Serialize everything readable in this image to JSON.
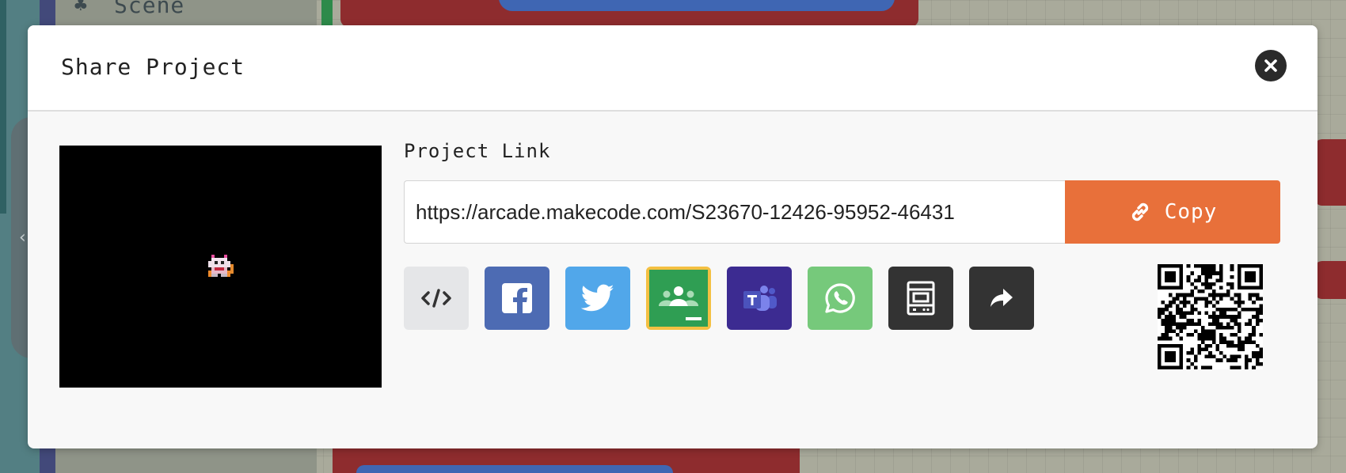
{
  "background": {
    "scene_label": "Scene",
    "scene_icon": "tree-icon"
  },
  "modal": {
    "title": "Share Project",
    "close_icon": "close-icon"
  },
  "project_link": {
    "label": "Project Link",
    "url": "https://arcade.makecode.com/S23670-12426-95952-46431",
    "copy_label": "Copy",
    "copy_icon": "link-icon"
  },
  "share_options": [
    {
      "id": "embed",
      "icon": "code-icon",
      "color": "#e5e6e8"
    },
    {
      "id": "facebook",
      "icon": "facebook-icon",
      "color": "#4d6bb3"
    },
    {
      "id": "twitter",
      "icon": "twitter-icon",
      "color": "#51a7ea"
    },
    {
      "id": "google-classroom",
      "icon": "google-classroom-icon",
      "color": "#2f9e53"
    },
    {
      "id": "microsoft-teams",
      "icon": "teams-icon",
      "color": "#3c2b91"
    },
    {
      "id": "whatsapp",
      "icon": "whatsapp-icon",
      "color": "#76c97b"
    },
    {
      "id": "arcade-kiosk",
      "icon": "arcade-cabinet-icon",
      "color": "#333333"
    },
    {
      "id": "share-more",
      "icon": "share-arrow-icon",
      "color": "#333333"
    }
  ],
  "colors": {
    "accent": "#e8703a",
    "modal_bg": "#f8f8f8",
    "classroom_border": "#f4c042"
  }
}
